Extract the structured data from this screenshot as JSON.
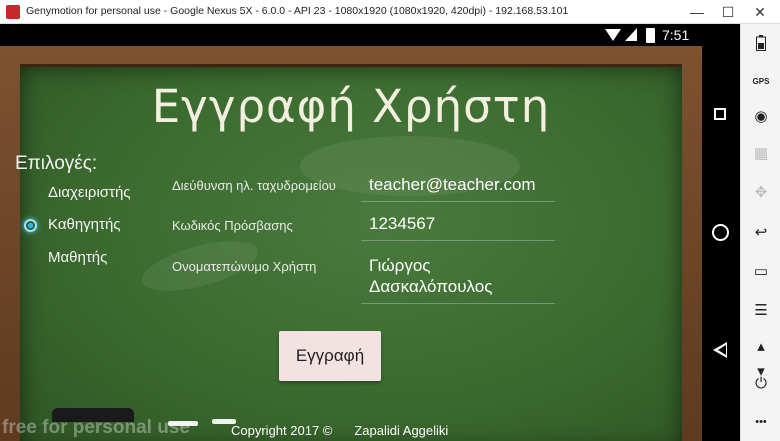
{
  "window": {
    "title": "Genymotion for personal use - Google Nexus 5X - 6.0.0 - API 23 - 1080x1920 (1080x1920, 420dpi) - 192.168.53.101",
    "minimize_glyph": "—",
    "maximize_glyph": "☐",
    "close_glyph": "✕"
  },
  "status_bar": {
    "time": "7:51"
  },
  "app": {
    "title": "Εγγραφή Χρήστη",
    "options_label": "Επιλογές:",
    "roles": [
      {
        "label": "Διαχειριστής",
        "selected": false
      },
      {
        "label": "Καθηγητής",
        "selected": true
      },
      {
        "label": "Μαθητής",
        "selected": false
      }
    ],
    "fields": {
      "email": {
        "label": "Διεύθυνση ηλ. ταχυδρομείου",
        "value": "teacher@teacher.com"
      },
      "password": {
        "label": "Κωδικός Πρόσβασης",
        "value": "1234567"
      },
      "fullname": {
        "label": "Ονοματεπώνυμο Χρήστη",
        "value": "Γιώργος Δασκαλόπουλος"
      }
    },
    "register_button": "Εγγραφή",
    "copyright": "Copyright 2017 ©",
    "author": "Zapalidi Aggeliki",
    "watermark": "free for personal use"
  },
  "toolbar": {
    "gps_label": "GPS",
    "icons": [
      "battery-icon",
      "gps-icon",
      "camera-icon",
      "media-icon",
      "dpad-icon",
      "back-icon",
      "recent-apps-icon",
      "menu-icon",
      "volume-up-icon",
      "volume-down-icon",
      "power-icon",
      "more-icon"
    ],
    "glyphs": {
      "camera": "◉",
      "media": "▦",
      "dpad": "✥",
      "back": "↩",
      "recent": "▭",
      "menu": "☰",
      "volume_up": "▴",
      "volume_down": "▾",
      "power": "⏻",
      "more": "•••"
    }
  }
}
